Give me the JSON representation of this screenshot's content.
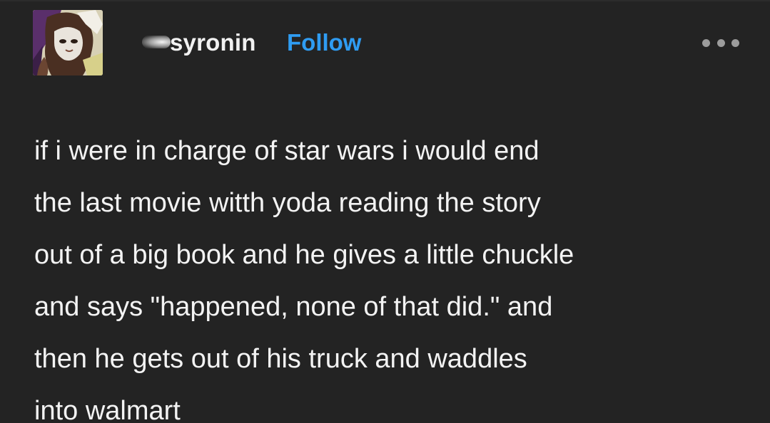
{
  "post": {
    "author": {
      "name": "syronin",
      "avatar_icon": "avatar-image",
      "follow_label": "Follow",
      "follow_color": "#2f9cf2"
    },
    "menu_icon": "more-options-icon",
    "body_lines": [
      "if i were in charge of star wars i would end",
      "the last movie witth yoda reading the story",
      "out of a big book and he gives a little chuckle",
      "and says \"happened, none of that did.\" and",
      "then he gets out of his truck and waddles",
      "into walmart"
    ]
  },
  "colors": {
    "background": "#232323",
    "text": "#f3f3f3",
    "accent": "#2f9cf2"
  }
}
